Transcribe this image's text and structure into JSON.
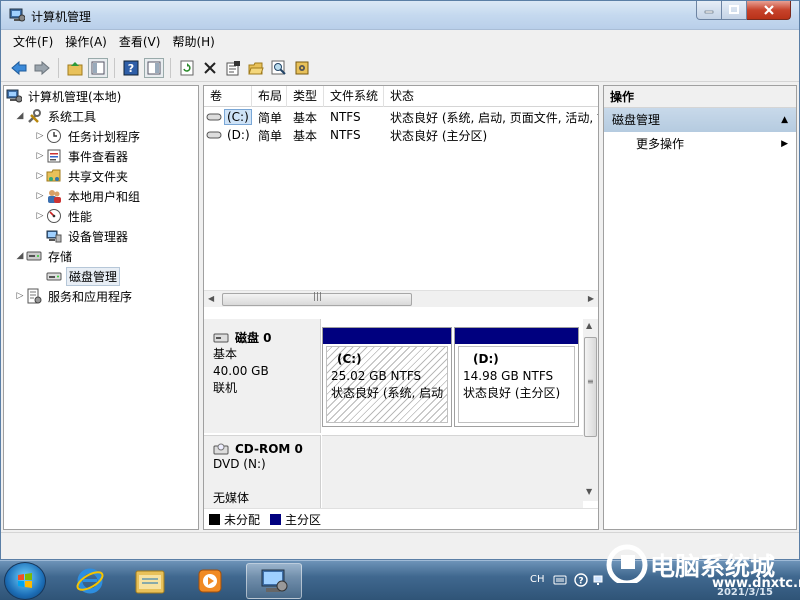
{
  "window": {
    "title": "计算机管理"
  },
  "menu": [
    "文件(F)",
    "操作(A)",
    "查看(V)",
    "帮助(H)"
  ],
  "toolbar": [
    "back-icon",
    "forward-icon",
    "up-folder-icon",
    "show-hide-tree-icon",
    "help-icon",
    "show-hide-action-pane-icon",
    "refresh-icon",
    "delete-icon",
    "properties-icon",
    "open-icon",
    "find-icon",
    "settings-icon"
  ],
  "tree": {
    "root": "计算机管理(本地)",
    "system_tools": "系统工具",
    "task_scheduler": "任务计划程序",
    "event_viewer": "事件查看器",
    "shared_folders": "共享文件夹",
    "local_users": "本地用户和组",
    "performance": "性能",
    "device_manager": "设备管理器",
    "storage": "存储",
    "disk_management": "磁盘管理",
    "services_apps": "服务和应用程序"
  },
  "volumes": {
    "columns": [
      "卷",
      "布局",
      "类型",
      "文件系统",
      "状态"
    ],
    "rows": [
      {
        "volume": "(C:)",
        "layout": "简单",
        "type": "基本",
        "fs": "NTFS",
        "status": "状态良好 (系统, 启动, 页面文件, 活动, 故"
      },
      {
        "volume": "(D:)",
        "layout": "简单",
        "type": "基本",
        "fs": "NTFS",
        "status": "状态良好 (主分区)"
      }
    ]
  },
  "disks": [
    {
      "name": "磁盘 0",
      "type": "基本",
      "size": "40.00 GB",
      "state": "联机",
      "partitions": [
        {
          "name": "(C:)",
          "size": "25.02 GB NTFS",
          "status": "状态良好 (系统, 启动,"
        },
        {
          "name": "(D:)",
          "size": "14.98 GB NTFS",
          "status": "状态良好 (主分区)"
        }
      ]
    },
    {
      "name": "CD-ROM 0",
      "type": "DVD (N:)",
      "media": "无媒体"
    }
  ],
  "legend": [
    {
      "label": "未分配",
      "color": "#000000"
    },
    {
      "label": "主分区",
      "color": "#00007f"
    }
  ],
  "actions": {
    "title": "操作",
    "section": "磁盘管理",
    "more": "更多操作"
  },
  "tray": {
    "lang": "CH"
  },
  "watermark": {
    "main": "电脑系统城",
    "url": "www.dnxtc.net",
    "date": "2021/3/15"
  },
  "colors": {
    "partition_bar": "#00007f",
    "action_section": "#c3d5e8",
    "taskbar": "#40688f"
  }
}
